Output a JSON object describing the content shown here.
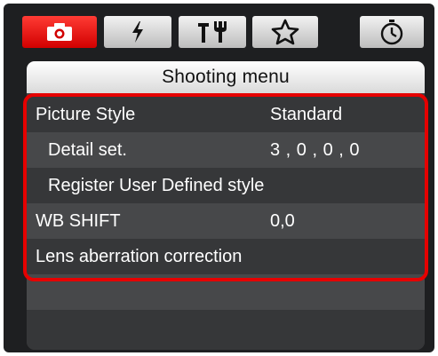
{
  "tabs": [
    {
      "icon": "camera-icon",
      "active": true
    },
    {
      "icon": "flash-bolt-icon",
      "active": false
    },
    {
      "icon": "tools-icon",
      "active": false
    },
    {
      "icon": "star-icon",
      "active": false
    },
    {
      "icon": "timer-icon",
      "active": false
    }
  ],
  "menu": {
    "title": "Shooting menu",
    "items": [
      {
        "label": "Picture Style",
        "value": "Standard"
      },
      {
        "label": "Detail set.",
        "value": "3 , 0 , 0 , 0"
      },
      {
        "label": "Register User Defined style",
        "value": ""
      },
      {
        "label": "WB SHIFT",
        "value": "0,0"
      },
      {
        "label": "Lens aberration correction",
        "value": ""
      }
    ]
  },
  "colors": {
    "active_tab": "#e60000",
    "highlight_border": "#e60000",
    "background": "#1e1f21"
  }
}
